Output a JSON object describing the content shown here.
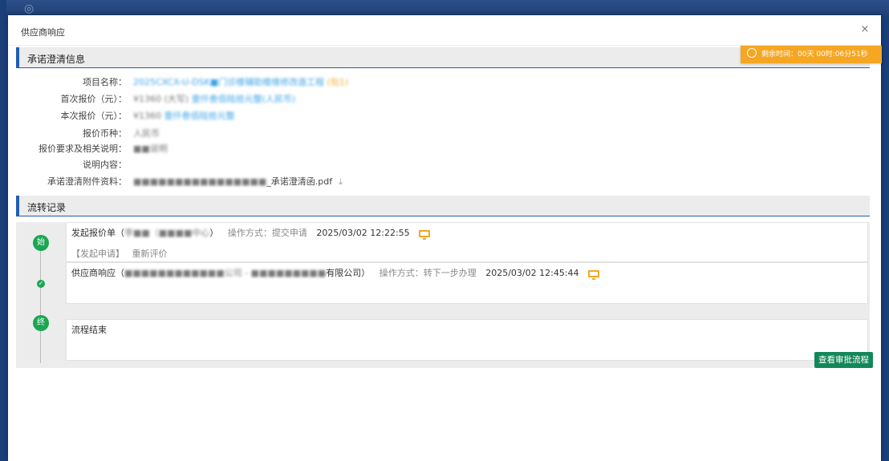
{
  "modal": {
    "title": "供应商响应",
    "close_symbol": "×"
  },
  "timer": {
    "text": "剩余时间：00天 00时:06分51秒"
  },
  "section1": {
    "title": "承诺澄清信息"
  },
  "info": {
    "project_name_label": "项目名称：",
    "project_name_value": "2025CXCX-U-DSK■门诊楼辅助楼维修改造工程",
    "project_name_tag": "(包1)",
    "first_quote_label": "首次报价（元）：",
    "first_quote_value": "¥1360 (大写)",
    "first_quote_value2": "壹仟叁佰陆拾元整(人民币)",
    "this_quote_label": "本次报价（元）：",
    "this_quote_value": "¥1360",
    "this_quote_value2": "壹仟叁佰陆拾元整",
    "currency_label": "报价币种：",
    "currency_value": "人民币",
    "req_label": "报价要求及相关说明：",
    "req_value": "■■说明",
    "desc_label": "说明内容：",
    "attach_label": "承诺澄清附件资料：",
    "attach_prefix": "■■■■■■■■■■■■■■■■",
    "attach_name": "_承诺澄清函.pdf"
  },
  "section2": {
    "title": "流转记录"
  },
  "flow": {
    "node1": "始",
    "node3": "终",
    "card1": {
      "action": "发起报价单（",
      "person": "李■■（■■■■中心",
      "action_end": "）",
      "op": "操作方式：提交申请",
      "time": "2025/03/02 12:22:55",
      "sub_tag": "【发起申请】",
      "sub_text": "重新评价"
    },
    "card2": {
      "action": "供应商响应（",
      "company": "■■■■■■■■■■■■公司 - ■■■■■■■■■",
      "company_end": "有限公司）",
      "op": "操作方式：转下一步办理",
      "time": "2025/03/02 12:45:44"
    },
    "card3": {
      "text": "流程结束"
    }
  },
  "buttons": {
    "view_flow": "查看审批流程"
  }
}
